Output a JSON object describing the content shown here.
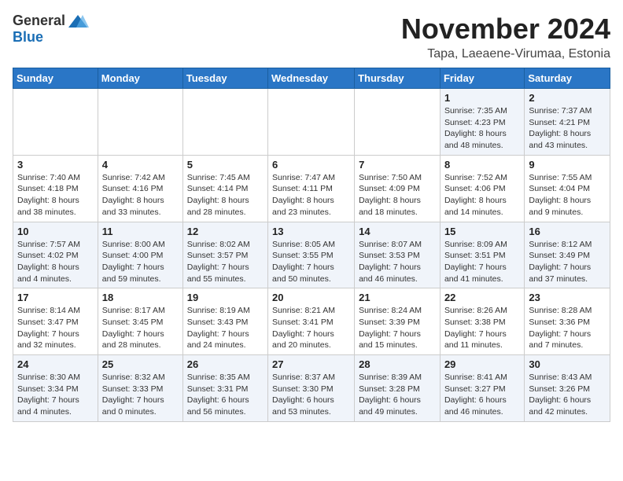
{
  "logo": {
    "general": "General",
    "blue": "Blue"
  },
  "title": "November 2024",
  "subtitle": "Tapa, Laeaene-Virumaa, Estonia",
  "weekdays": [
    "Sunday",
    "Monday",
    "Tuesday",
    "Wednesday",
    "Thursday",
    "Friday",
    "Saturday"
  ],
  "weeks": [
    [
      {
        "day": "",
        "info": ""
      },
      {
        "day": "",
        "info": ""
      },
      {
        "day": "",
        "info": ""
      },
      {
        "day": "",
        "info": ""
      },
      {
        "day": "",
        "info": ""
      },
      {
        "day": "1",
        "info": "Sunrise: 7:35 AM\nSunset: 4:23 PM\nDaylight: 8 hours\nand 48 minutes."
      },
      {
        "day": "2",
        "info": "Sunrise: 7:37 AM\nSunset: 4:21 PM\nDaylight: 8 hours\nand 43 minutes."
      }
    ],
    [
      {
        "day": "3",
        "info": "Sunrise: 7:40 AM\nSunset: 4:18 PM\nDaylight: 8 hours\nand 38 minutes."
      },
      {
        "day": "4",
        "info": "Sunrise: 7:42 AM\nSunset: 4:16 PM\nDaylight: 8 hours\nand 33 minutes."
      },
      {
        "day": "5",
        "info": "Sunrise: 7:45 AM\nSunset: 4:14 PM\nDaylight: 8 hours\nand 28 minutes."
      },
      {
        "day": "6",
        "info": "Sunrise: 7:47 AM\nSunset: 4:11 PM\nDaylight: 8 hours\nand 23 minutes."
      },
      {
        "day": "7",
        "info": "Sunrise: 7:50 AM\nSunset: 4:09 PM\nDaylight: 8 hours\nand 18 minutes."
      },
      {
        "day": "8",
        "info": "Sunrise: 7:52 AM\nSunset: 4:06 PM\nDaylight: 8 hours\nand 14 minutes."
      },
      {
        "day": "9",
        "info": "Sunrise: 7:55 AM\nSunset: 4:04 PM\nDaylight: 8 hours\nand 9 minutes."
      }
    ],
    [
      {
        "day": "10",
        "info": "Sunrise: 7:57 AM\nSunset: 4:02 PM\nDaylight: 8 hours\nand 4 minutes."
      },
      {
        "day": "11",
        "info": "Sunrise: 8:00 AM\nSunset: 4:00 PM\nDaylight: 7 hours\nand 59 minutes."
      },
      {
        "day": "12",
        "info": "Sunrise: 8:02 AM\nSunset: 3:57 PM\nDaylight: 7 hours\nand 55 minutes."
      },
      {
        "day": "13",
        "info": "Sunrise: 8:05 AM\nSunset: 3:55 PM\nDaylight: 7 hours\nand 50 minutes."
      },
      {
        "day": "14",
        "info": "Sunrise: 8:07 AM\nSunset: 3:53 PM\nDaylight: 7 hours\nand 46 minutes."
      },
      {
        "day": "15",
        "info": "Sunrise: 8:09 AM\nSunset: 3:51 PM\nDaylight: 7 hours\nand 41 minutes."
      },
      {
        "day": "16",
        "info": "Sunrise: 8:12 AM\nSunset: 3:49 PM\nDaylight: 7 hours\nand 37 minutes."
      }
    ],
    [
      {
        "day": "17",
        "info": "Sunrise: 8:14 AM\nSunset: 3:47 PM\nDaylight: 7 hours\nand 32 minutes."
      },
      {
        "day": "18",
        "info": "Sunrise: 8:17 AM\nSunset: 3:45 PM\nDaylight: 7 hours\nand 28 minutes."
      },
      {
        "day": "19",
        "info": "Sunrise: 8:19 AM\nSunset: 3:43 PM\nDaylight: 7 hours\nand 24 minutes."
      },
      {
        "day": "20",
        "info": "Sunrise: 8:21 AM\nSunset: 3:41 PM\nDaylight: 7 hours\nand 20 minutes."
      },
      {
        "day": "21",
        "info": "Sunrise: 8:24 AM\nSunset: 3:39 PM\nDaylight: 7 hours\nand 15 minutes."
      },
      {
        "day": "22",
        "info": "Sunrise: 8:26 AM\nSunset: 3:38 PM\nDaylight: 7 hours\nand 11 minutes."
      },
      {
        "day": "23",
        "info": "Sunrise: 8:28 AM\nSunset: 3:36 PM\nDaylight: 7 hours\nand 7 minutes."
      }
    ],
    [
      {
        "day": "24",
        "info": "Sunrise: 8:30 AM\nSunset: 3:34 PM\nDaylight: 7 hours\nand 4 minutes."
      },
      {
        "day": "25",
        "info": "Sunrise: 8:32 AM\nSunset: 3:33 PM\nDaylight: 7 hours\nand 0 minutes."
      },
      {
        "day": "26",
        "info": "Sunrise: 8:35 AM\nSunset: 3:31 PM\nDaylight: 6 hours\nand 56 minutes."
      },
      {
        "day": "27",
        "info": "Sunrise: 8:37 AM\nSunset: 3:30 PM\nDaylight: 6 hours\nand 53 minutes."
      },
      {
        "day": "28",
        "info": "Sunrise: 8:39 AM\nSunset: 3:28 PM\nDaylight: 6 hours\nand 49 minutes."
      },
      {
        "day": "29",
        "info": "Sunrise: 8:41 AM\nSunset: 3:27 PM\nDaylight: 6 hours\nand 46 minutes."
      },
      {
        "day": "30",
        "info": "Sunrise: 8:43 AM\nSunset: 3:26 PM\nDaylight: 6 hours\nand 42 minutes."
      }
    ]
  ]
}
